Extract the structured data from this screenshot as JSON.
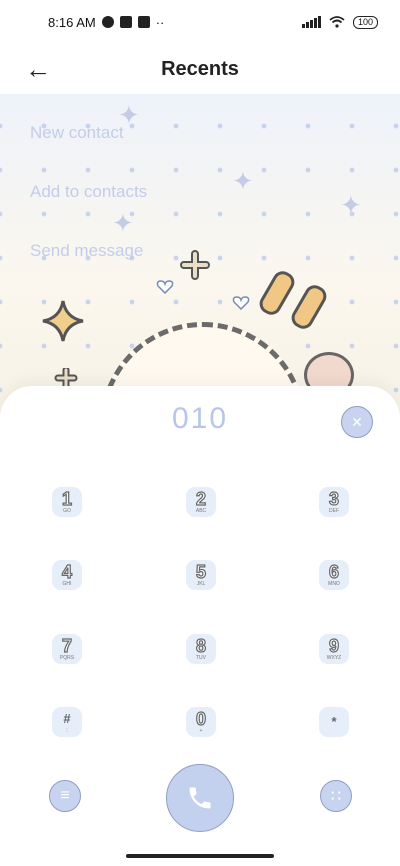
{
  "status_bar": {
    "time": "8:16 AM",
    "dots": "··",
    "battery": "100"
  },
  "header": {
    "title": "Recents",
    "back_icon": "←"
  },
  "menu": {
    "items": [
      {
        "label": "New contact"
      },
      {
        "label": "Add to contacts"
      },
      {
        "label": "Send message"
      }
    ]
  },
  "dialpad": {
    "number": "010",
    "clear_icon": "✕",
    "keys": [
      {
        "digit": "1",
        "letters": "GO"
      },
      {
        "digit": "2",
        "letters": "ABC"
      },
      {
        "digit": "3",
        "letters": "DEF"
      },
      {
        "digit": "4",
        "letters": "GHI"
      },
      {
        "digit": "5",
        "letters": "JKL"
      },
      {
        "digit": "6",
        "letters": "MNO"
      },
      {
        "digit": "7",
        "letters": "PQRS"
      },
      {
        "digit": "8",
        "letters": "TUV"
      },
      {
        "digit": "9",
        "letters": "WXYZ"
      },
      {
        "digit": "#",
        "letters": ";"
      },
      {
        "digit": "0",
        "letters": "+"
      },
      {
        "digit": "*",
        "letters": ""
      }
    ],
    "menu_icon": "≡",
    "grid_icon": "∷",
    "call_icon": "phone-icon"
  },
  "colors": {
    "accent": "#c3d1ee",
    "menu_text": "#c3cdea",
    "key_bg": "#e6eefa"
  }
}
